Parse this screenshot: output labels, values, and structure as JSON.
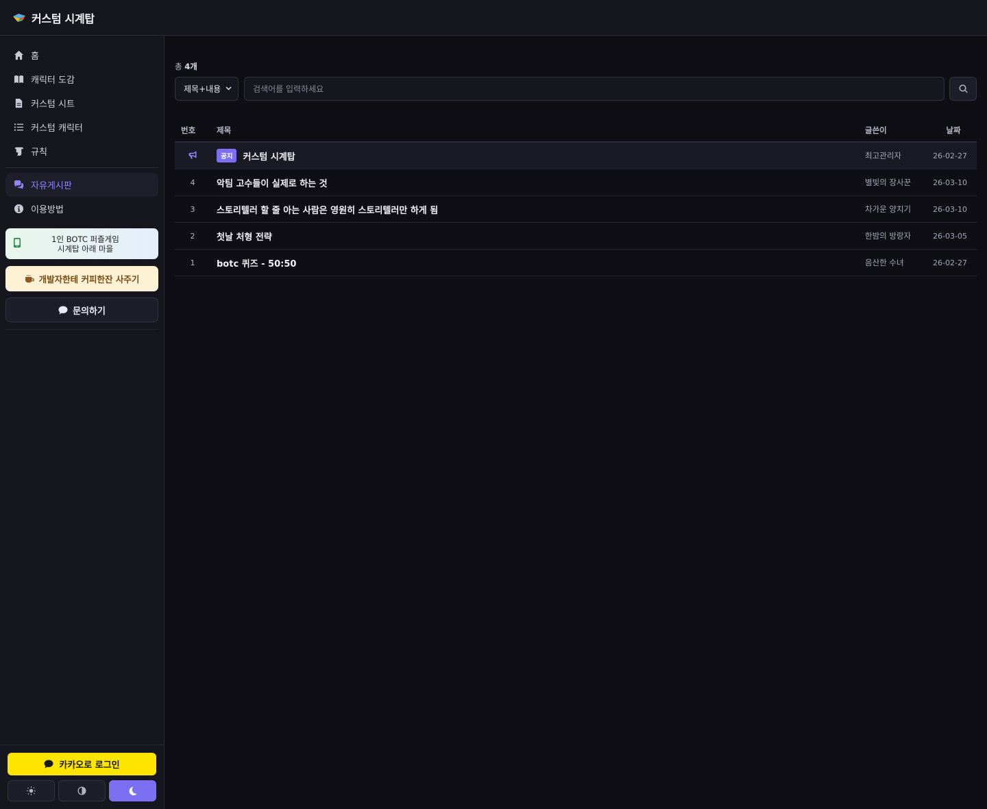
{
  "header": {
    "title": "커스텀 시계탑"
  },
  "sidebar": {
    "items": [
      {
        "label": "홈",
        "icon": "home-icon"
      },
      {
        "label": "캐릭터 도감",
        "icon": "book-icon"
      },
      {
        "label": "커스텀 시트",
        "icon": "file-icon"
      },
      {
        "label": "커스텀 캐릭터",
        "icon": "list-icon"
      },
      {
        "label": "규칙",
        "icon": "scroll-icon"
      }
    ],
    "items2": [
      {
        "label": "자유게시판",
        "icon": "comments-icon",
        "active": true
      },
      {
        "label": "이용방법",
        "icon": "info-icon"
      }
    ],
    "promo": {
      "line1": "1인 BOTC 퍼즐게임",
      "line2": "시계탑 아래 마을"
    },
    "coffee": "개발자한테 커피한잔 사주기",
    "inquiry": "문의하기",
    "login": "카카오로 로그인"
  },
  "theme": {
    "accent": "#7d6ff2",
    "kakao": "#fee500"
  },
  "board": {
    "count_prefix": "총 ",
    "count_value": "4개",
    "select_value": "제목+내용",
    "search_placeholder": "검색어를 입력하세요",
    "headers": {
      "num": "번호",
      "title": "제목",
      "author": "글쓴이",
      "date": "날짜"
    },
    "notice": {
      "badge": "공지",
      "title": "커스텀 시계탑",
      "author": "최고관리자",
      "date": "26-02-27"
    },
    "posts": [
      {
        "num": "4",
        "title": "악팀 고수들이 실제로 하는 것",
        "author": "별빛의 장사꾼",
        "date": "26-03-10"
      },
      {
        "num": "3",
        "title": "스토리텔러 할 줄 아는 사람은 영원히 스토리텔러만 하게 됨",
        "author": "차가운 양치기",
        "date": "26-03-10"
      },
      {
        "num": "2",
        "title": "첫날 처형 전략",
        "author": "한밤의 방랑자",
        "date": "26-03-05"
      },
      {
        "num": "1",
        "title": "botc 퀴즈 - 50:50",
        "author": "음산한 수녀",
        "date": "26-02-27"
      }
    ]
  }
}
